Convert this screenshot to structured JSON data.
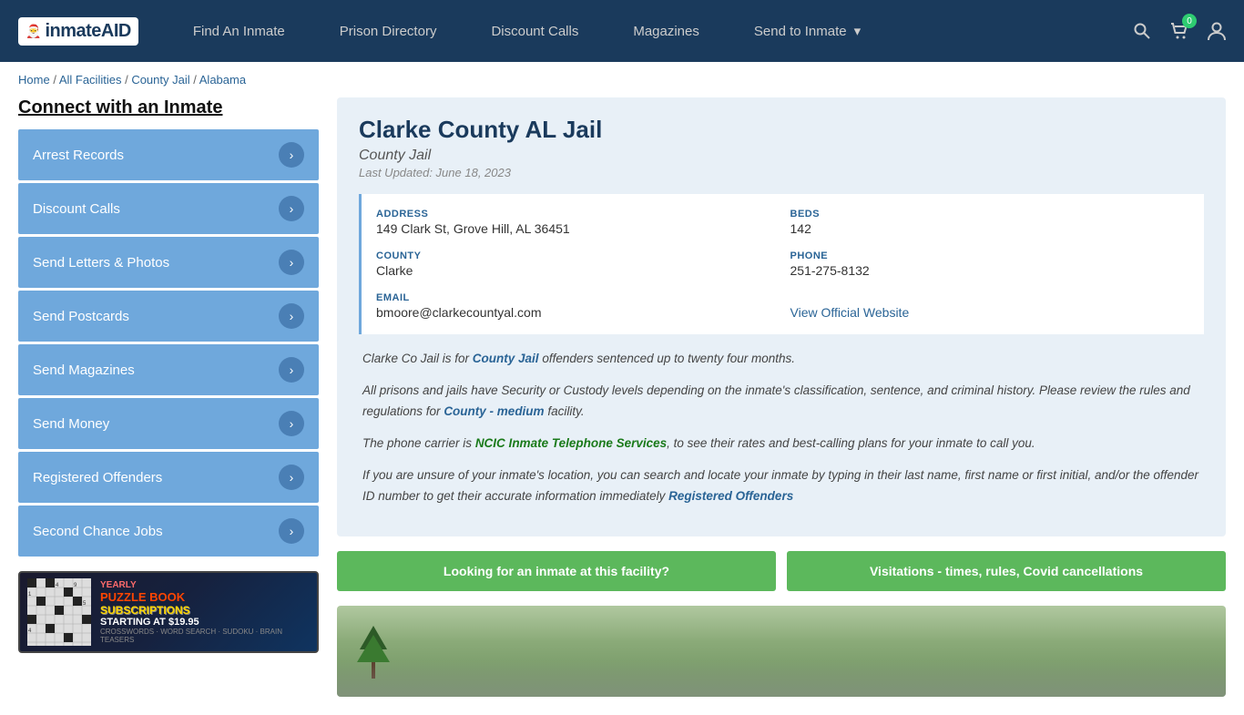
{
  "header": {
    "logo_text": "inmateAID",
    "nav": [
      {
        "label": "Find An Inmate",
        "id": "find-inmate"
      },
      {
        "label": "Prison Directory",
        "id": "prison-directory"
      },
      {
        "label": "Discount Calls",
        "id": "discount-calls"
      },
      {
        "label": "Magazines",
        "id": "magazines"
      },
      {
        "label": "Send to Inmate",
        "id": "send-to-inmate",
        "has_dropdown": true
      }
    ],
    "cart_count": "0",
    "icons": [
      "search",
      "cart",
      "user"
    ]
  },
  "breadcrumb": {
    "items": [
      "Home",
      "All Facilities",
      "County Jail",
      "Alabama"
    ]
  },
  "sidebar": {
    "title": "Connect with an Inmate",
    "menu_items": [
      {
        "label": "Arrest Records",
        "id": "arrest-records"
      },
      {
        "label": "Discount Calls",
        "id": "discount-calls"
      },
      {
        "label": "Send Letters & Photos",
        "id": "send-letters"
      },
      {
        "label": "Send Postcards",
        "id": "send-postcards"
      },
      {
        "label": "Send Magazines",
        "id": "send-magazines"
      },
      {
        "label": "Send Money",
        "id": "send-money"
      },
      {
        "label": "Registered Offenders",
        "id": "registered-offenders"
      },
      {
        "label": "Second Chance Jobs",
        "id": "second-chance-jobs"
      }
    ],
    "ad": {
      "tag_yearly": "YEARLY",
      "tag_puzzle": "PUZZLE BOOK",
      "tag_subscriptions": "SUBSCRIPTIONS",
      "starting_at": "STARTING AT $19.95",
      "sub_types": "CROSSWORDS · WORD SEARCH · SUDOKU · BRAIN TEASERS"
    }
  },
  "facility": {
    "name": "Clarke County AL Jail",
    "type": "County Jail",
    "last_updated": "Last Updated: June 18, 2023",
    "address_label": "ADDRESS",
    "address_value": "149 Clark St, Grove Hill, AL 36451",
    "beds_label": "BEDS",
    "beds_value": "142",
    "county_label": "COUNTY",
    "county_value": "Clarke",
    "phone_label": "PHONE",
    "phone_value": "251-275-8132",
    "email_label": "EMAIL",
    "email_value": "bmoore@clarkecountyal.com",
    "website_label": "View Official Website",
    "website_url": "#",
    "description_1": "Clarke Co Jail is for County Jail offenders sentenced up to twenty four months.",
    "description_2": "All prisons and jails have Security or Custody levels depending on the inmate's classification, sentence, and criminal history. Please review the rules and regulations for County - medium facility.",
    "description_3": "The phone carrier is NCIC Inmate Telephone Services, to see their rates and best-calling plans for your inmate to call you.",
    "description_4": "If you are unsure of your inmate's location, you can search and locate your inmate by typing in their last name, first name or first initial, and/or the offender ID number to get their accurate information immediately Registered Offenders",
    "btn_looking": "Looking for an inmate at this facility?",
    "btn_visitations": "Visitations - times, rules, Covid cancellations"
  }
}
